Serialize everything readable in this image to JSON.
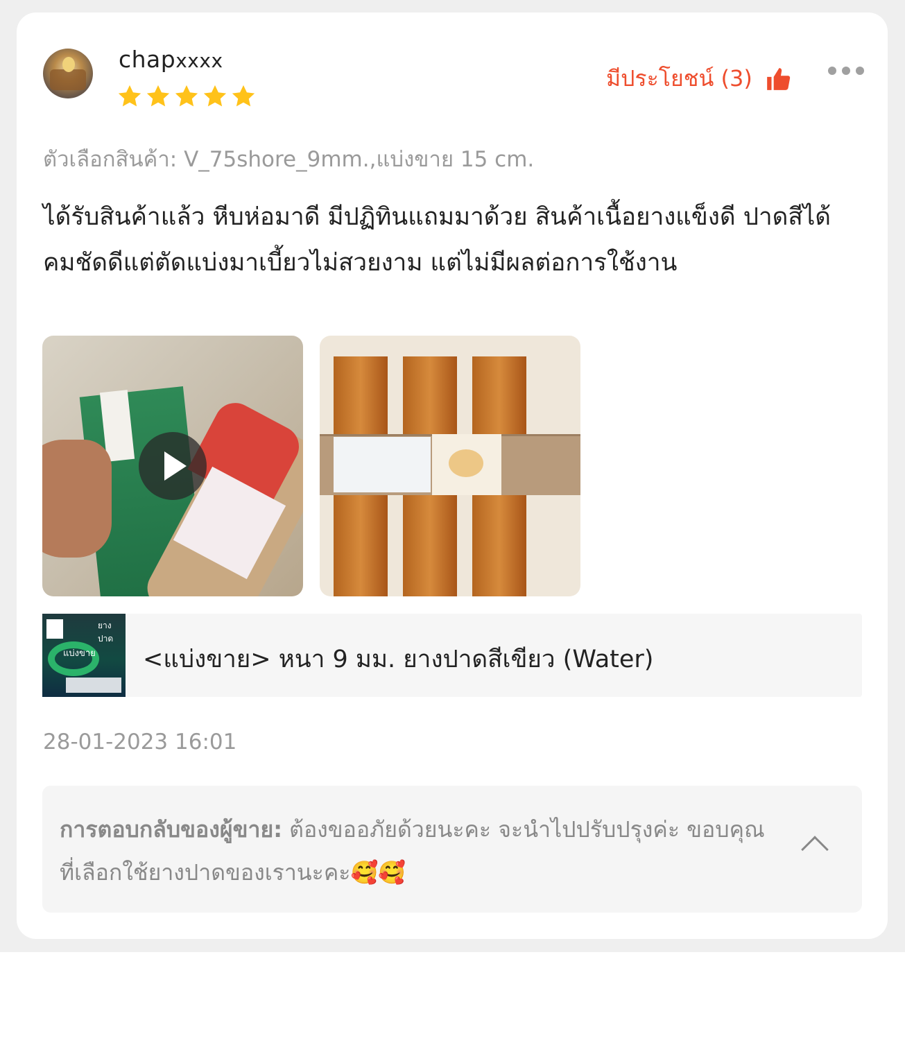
{
  "review": {
    "username": "chap",
    "username_suffix": "xxxx",
    "rating": 5,
    "helpful_label": "มีประโยชน์ (3)",
    "variant": "ตัวเลือกสินค้า: V_75shore_9mm.,แบ่งขาย 15 cm.",
    "text": "ได้รับสินค้าแล้ว หีบห่อมาดี มีปฏิทินแถมมาด้วย สินค้าเนื้อยางแข็งดี ปาดสีได้คมชัดดีแต่ตัดแบ่งมาเบี้ยวไม่สวยงาม แต่ไม่มีผลต่อการใช้งาน",
    "timestamp": "28-01-2023 16:01"
  },
  "product": {
    "name": "<แบ่งขาย> หนา 9 มม. ยางปาดสีเขียว (Water)",
    "thumb_badge": "แบ่งขาย",
    "thumb_title": "ยางปาด"
  },
  "seller_reply": {
    "label": "การตอบกลับของผู้ขาย:",
    "text": " ต้องขออภัยด้วยนะคะ จะนำไปปรับปรุงค่ะ ขอบคุณที่เลือกใช้ยางปาดของเรานะคะ🥰🥰"
  },
  "colors": {
    "accent": "#ee4d2d",
    "star": "#ffc21a"
  },
  "icons": [
    "thumbs-up-icon",
    "more-options-icon",
    "star-icon",
    "play-icon",
    "chevron-up-icon"
  ]
}
